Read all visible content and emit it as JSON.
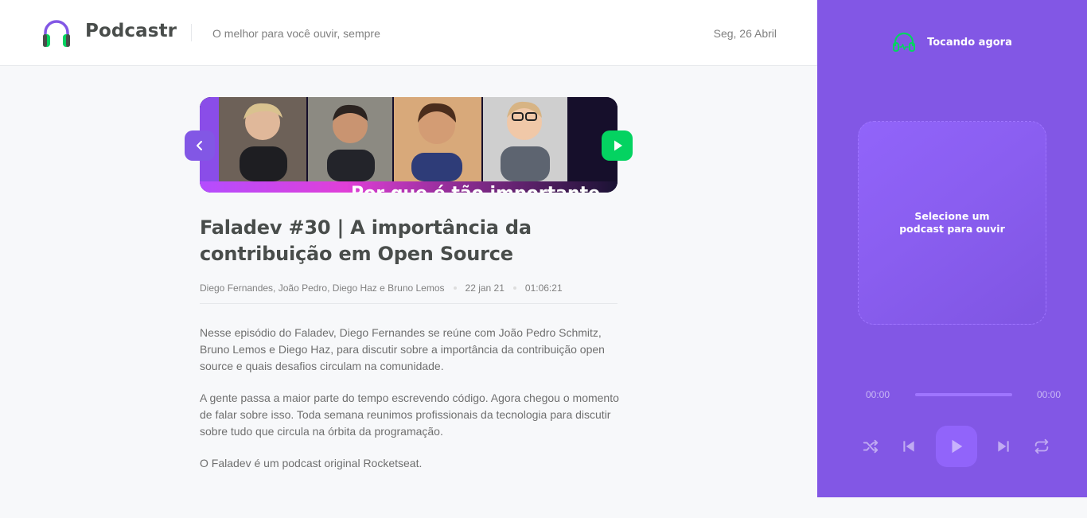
{
  "header": {
    "app_name": "Podcastr",
    "tagline": "O melhor para você ouvir, sempre",
    "date": "Seg, 26 Abril",
    "logo_icon": "headphones-icon"
  },
  "episode": {
    "thumbnail_caption": "Por que é tão importante",
    "title": "Faladev #30 | A importância da contribuição em Open Source",
    "members": "Diego Fernandes, João Pedro, Diego Haz e Bruno Lemos",
    "published_at": "22 jan 21",
    "duration": "01:06:21",
    "description": [
      "Nesse episódio do Faladev, Diego Fernandes se reúne com João Pedro Schmitz, Bruno Lemos e Diego Haz, para discutir sobre a importância da contribuição open source e quais desafios circulam na comunidade.",
      "A gente passa a maior parte do tempo escrevendo código. Agora chegou o momento de falar sobre isso. Toda semana reunimos profissionais da tecnologia para discutir sobre tudo que circula na órbita da programação.",
      "O Faladev é um podcast original Rocketseat."
    ],
    "back_icon": "chevron-left-icon",
    "play_icon": "play-icon"
  },
  "player": {
    "header_label": "Tocando agora",
    "header_icon": "headphones-playing-icon",
    "empty_line1": "Selecione um",
    "empty_line2": "podcast para ouvir",
    "current_time": "00:00",
    "total_time": "00:00",
    "progress": 0,
    "controls": [
      "shuffle-icon",
      "previous-icon",
      "play-icon",
      "next-icon",
      "repeat-icon"
    ]
  },
  "colors": {
    "brand_purple": "#8257e5",
    "brand_green": "#04d361",
    "text_dark": "#494d4b",
    "text_muted": "#808080"
  }
}
